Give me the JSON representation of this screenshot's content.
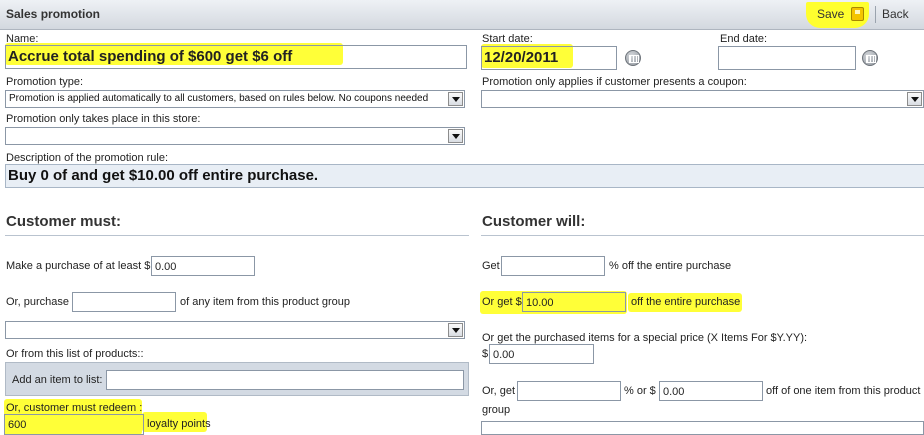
{
  "window": {
    "title": "Sales promotion"
  },
  "toolbar": {
    "save_label": "Save",
    "back_label": "Back"
  },
  "name": {
    "label": "Name:",
    "value": "Accrue total spending of $600 get $6 off"
  },
  "start_date": {
    "label": "Start date:",
    "value": "12/20/2011"
  },
  "end_date": {
    "label": "End date:",
    "value": ""
  },
  "promotion_type": {
    "label": "Promotion type:",
    "selected": "Promotion is applied automatically to all customers, based on rules below. No coupons needed"
  },
  "coupon": {
    "label": "Promotion only applies if customer presents a coupon:",
    "selected": ""
  },
  "store": {
    "label": "Promotion only takes place in this store:",
    "selected": ""
  },
  "description": {
    "label": "Description of the promotion rule:",
    "value": "Buy 0 of  and get $10.00 off entire purchase."
  },
  "customer_must": {
    "title": "Customer must:",
    "purchase_label": "Make a purchase of at least $",
    "purchase_value": "0.00",
    "or_purchase_label": "Or, purchase",
    "or_purchase_value": "",
    "product_group_label": "of any item from this product group",
    "product_group_selected": "",
    "list_label": "Or from this list of products::",
    "add_item_label": "Add an item to list:",
    "add_item_value": "",
    "redeem_label": "Or, customer must redeem :",
    "redeem_value": "600",
    "loyalty_label": "loyalty points"
  },
  "customer_will": {
    "title": "Customer will:",
    "get_label": "Get",
    "get_value": "",
    "get_suffix": "% off the entire purchase",
    "or_get_label": "Or get $",
    "or_get_value": "10.00",
    "or_get_suffix": "off the entire purchase",
    "special_price_label": "Or get the purchased items for a special price (X Items For $Y.YY):",
    "special_price_prefix": "$",
    "special_price_value": "0.00",
    "or_get2_label": "Or, get",
    "or_get2_value": "",
    "percent_or_label": "% or $",
    "dollar_value": "0.00",
    "one_item_suffix": "off of one item from this product",
    "group_label": "group",
    "group_selected": ""
  },
  "colors": {
    "highlight": "#ffff38",
    "title_bar": "#d3d8df",
    "description_bg": "#e8eef5"
  }
}
